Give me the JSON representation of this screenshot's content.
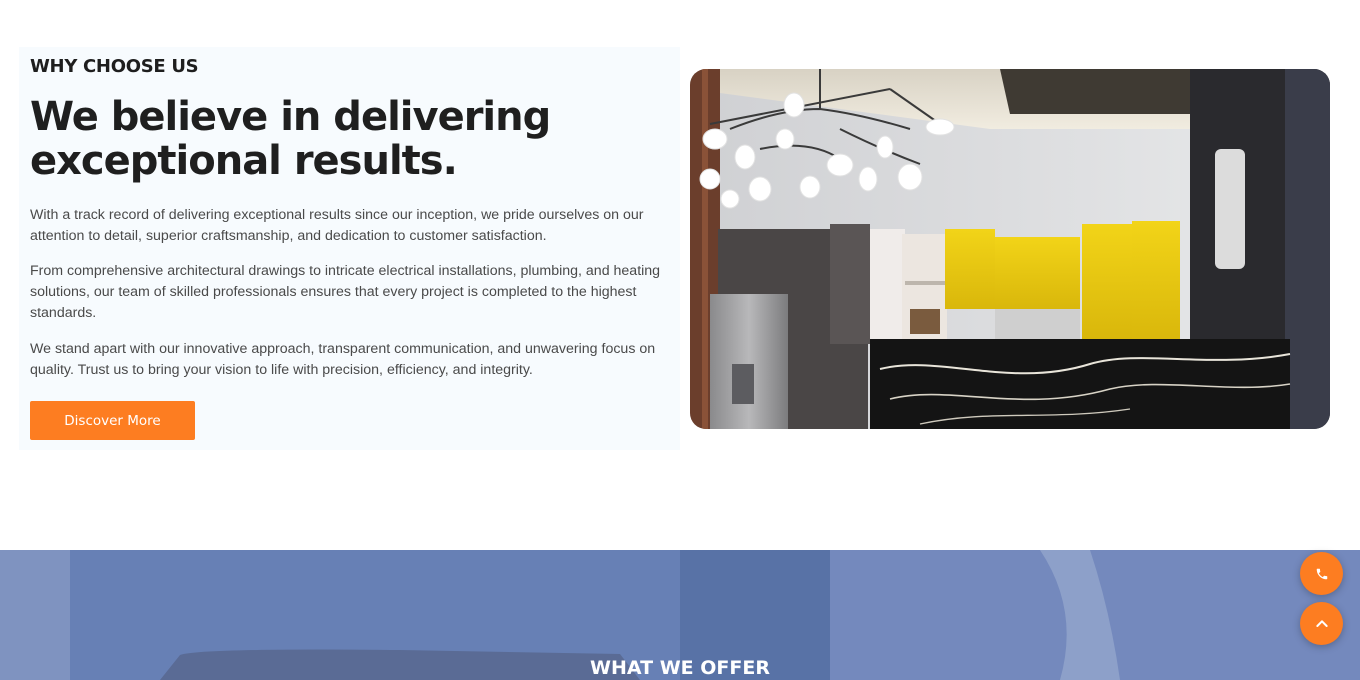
{
  "why_section": {
    "eyebrow": "WHY CHOOSE US",
    "headline": "We believe in delivering exceptional results.",
    "paragraphs": [
      "With a track record of delivering exceptional results since our inception, we pride ourselves on our attention to detail, superior craftsmanship, and dedication to customer satisfaction.",
      "From comprehensive architectural drawings to intricate electrical installations, plumbing, and heating solutions, our team of skilled professionals ensures that every project is completed to the highest standards.",
      "We stand apart with our innovative approach, transparent communication, and unwavering focus on quality. Trust us to bring your vision to life with precision, efficiency, and integrity."
    ],
    "cta_label": "Discover More",
    "image_icon": "kitchen-photo"
  },
  "offer_section": {
    "title": "WHAT WE OFFER"
  },
  "floating_buttons": {
    "call_icon": "phone-icon",
    "top_icon": "chevron-up-icon"
  },
  "colors": {
    "accent": "#fd7d21",
    "panel_bg": "#f7fbfe",
    "heading": "#1f1f1f",
    "body_text": "#4a4a4a",
    "offer_overlay": "#6a84b8"
  }
}
